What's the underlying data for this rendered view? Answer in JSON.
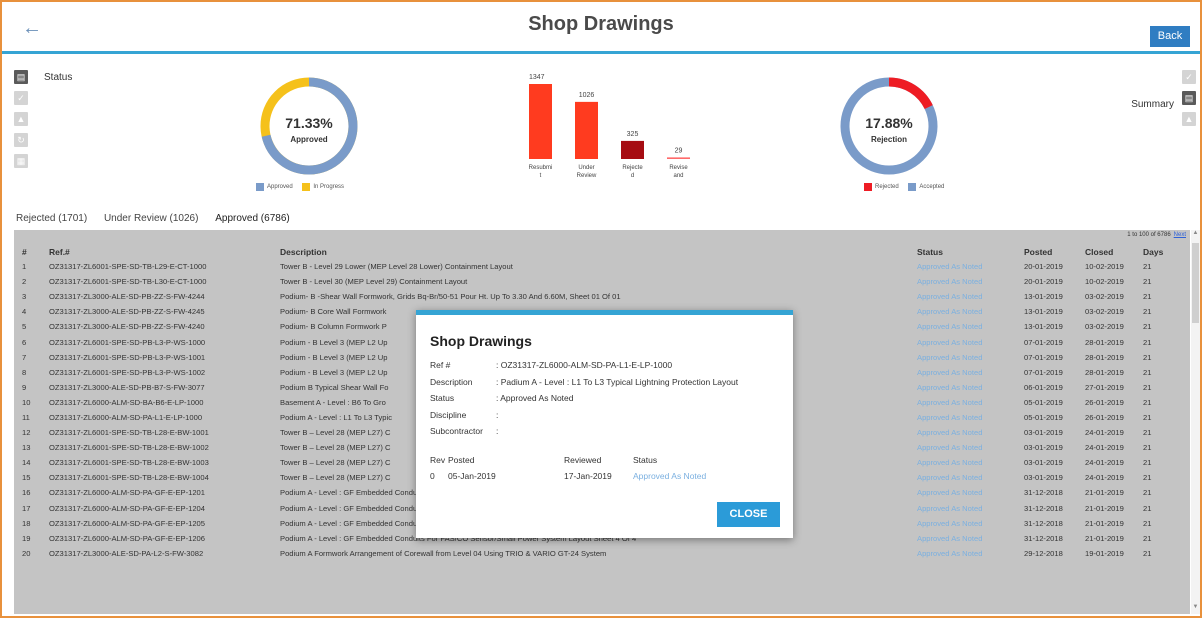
{
  "header": {
    "title": "Shop Drawings",
    "back_label": "Back"
  },
  "status_label": "Status",
  "summary_label": "Summary",
  "approval_donut": {
    "percent": "71.33%",
    "label": "Approved",
    "fraction": 0.7133,
    "legend": [
      "Approved",
      "In Progress"
    ],
    "colors": [
      "#7a9bc9",
      "#f5c11b"
    ]
  },
  "rejection_donut": {
    "percent": "17.88%",
    "label": "Rejection",
    "fraction": 0.1788,
    "legend": [
      "Rejected",
      "Accepted"
    ],
    "colors": [
      "#ee1c24",
      "#7a9bc9"
    ]
  },
  "chart_data": {
    "type": "bar",
    "categories": [
      "Resubmit",
      "Under Review",
      "Rejected",
      "Revise and"
    ],
    "category_lines": [
      [
        "Resubmi",
        "t"
      ],
      [
        "Under",
        "Review"
      ],
      [
        "Rejecte",
        "d"
      ],
      [
        "Revise",
        "and"
      ]
    ],
    "values": [
      1347,
      1026,
      325,
      29
    ],
    "colors": [
      "#ff3b1f",
      "#ff3b1f",
      "#a60c12",
      "#ff6a6a"
    ],
    "ylim": [
      0,
      1347
    ]
  },
  "tabs": [
    {
      "label": "Rejected (1701)"
    },
    {
      "label": "Under Review (1026)"
    },
    {
      "label": "Approved (6786)"
    }
  ],
  "pager": {
    "range": "1 to 100 of 6786",
    "next": "Next"
  },
  "table": {
    "headers": [
      "#",
      "Ref.#",
      "Description",
      "Status",
      "Posted",
      "Closed",
      "Days"
    ],
    "rows": [
      [
        "1",
        "OZ31317-ZL6001-SPE-SD-TB-L29-E-CT-1000",
        "Tower B - Level 29 Lower (MEP Level 28 Lower) Containment Layout",
        "Approved As Noted",
        "20-01-2019",
        "10-02-2019",
        "21"
      ],
      [
        "2",
        "OZ31317-ZL6001-SPE-SD-TB-L30-E-CT-1000",
        "Tower B - Level 30 (MEP Level 29) Containment Layout",
        "Approved As Noted",
        "20-01-2019",
        "10-02-2019",
        "21"
      ],
      [
        "3",
        "OZ31317-ZL3000-ALE-SD-PB-ZZ-S-FW-4244",
        "Podium- B -Shear Wall Formwork, Grids Bq-Br/50-51 Pour Ht. Up To 3.30 And 6.60M, Sheet 01 Of 01",
        "Approved As Noted",
        "13-01-2019",
        "03-02-2019",
        "21"
      ],
      [
        "4",
        "OZ31317-ZL3000-ALE-SD-PB-ZZ-S-FW-4245",
        "Podium- B Core Wall Formwork",
        "Approved As Noted",
        "13-01-2019",
        "03-02-2019",
        "21"
      ],
      [
        "5",
        "OZ31317-ZL3000-ALE-SD-PB-ZZ-S-FW-4240",
        "Podium- B Column Formwork P",
        "Approved As Noted",
        "13-01-2019",
        "03-02-2019",
        "21"
      ],
      [
        "6",
        "OZ31317-ZL6001-SPE-SD-PB-L3-P-WS-1000",
        "Podium - B Level 3 (MEP L2 Up",
        "Approved As Noted",
        "07-01-2019",
        "28-01-2019",
        "21"
      ],
      [
        "7",
        "OZ31317-ZL6001-SPE-SD-PB-L3-P-WS-1001",
        "Podium - B Level 3 (MEP L2 Up",
        "Approved As Noted",
        "07-01-2019",
        "28-01-2019",
        "21"
      ],
      [
        "8",
        "OZ31317-ZL6001-SPE-SD-PB-L3-P-WS-1002",
        "Podium - B Level 3 (MEP L2 Up",
        "Approved As Noted",
        "07-01-2019",
        "28-01-2019",
        "21"
      ],
      [
        "9",
        "OZ31317-ZL3000-ALE-SD-PB-B7-S-FW-3077",
        "Podium B Typical Shear Wall Fo",
        "Approved As Noted",
        "06-01-2019",
        "27-01-2019",
        "21"
      ],
      [
        "10",
        "OZ31317-ZL6000-ALM-SD-BA-B6-E-LP-1000",
        "Basement A - Level : B6 To Gro",
        "Approved As Noted",
        "05-01-2019",
        "26-01-2019",
        "21"
      ],
      [
        "11",
        "OZ31317-ZL6000-ALM-SD-PA-L1-E-LP-1000",
        "Podium A - Level : L1 To L3 Typic",
        "Approved As Noted",
        "05-01-2019",
        "26-01-2019",
        "21"
      ],
      [
        "12",
        "OZ31317-ZL6001-SPE-SD-TB-L28-E-BW-1001",
        "Tower B – Level 28 (MEP L27) C",
        "Approved As Noted",
        "03-01-2019",
        "24-01-2019",
        "21"
      ],
      [
        "13",
        "OZ31317-ZL6001-SPE-SD-TB-L28-E-BW-1002",
        "Tower B – Level 28 (MEP L27) C",
        "Approved As Noted",
        "03-01-2019",
        "24-01-2019",
        "21"
      ],
      [
        "14",
        "OZ31317-ZL6001-SPE-SD-TB-L28-E-BW-1003",
        "Tower B – Level 28 (MEP L27) C",
        "Approved As Noted",
        "03-01-2019",
        "24-01-2019",
        "21"
      ],
      [
        "15",
        "OZ31317-ZL6001-SPE-SD-TB-L28-E-BW-1004",
        "Tower B – Level 28 (MEP L27) C",
        "Approved As Noted",
        "03-01-2019",
        "24-01-2019",
        "21"
      ],
      [
        "16",
        "OZ31317-ZL6000-ALM-SD-PA-GF-E-EP-1201",
        "Podium A - Level : GF Embedded Conduits For FAS/CO Sensor/Small Power System Layout Sheet 1 Of 4",
        "Approved As Noted",
        "31-12-2018",
        "21-01-2019",
        "21"
      ],
      [
        "17",
        "OZ31317-ZL6000-ALM-SD-PA-GF-E-EP-1204",
        "Podium A - Level : GF Embedded Conduits For FAS/CO Sensor/Small Power System Layout Sheet 2 Of 4 \"",
        "Approved As Noted",
        "31-12-2018",
        "21-01-2019",
        "21"
      ],
      [
        "18",
        "OZ31317-ZL6000-ALM-SD-PA-GF-E-EP-1205",
        "Podium A - Level : GF Embedded Conduits For FAS/CO Sensor/Small Power System Layout Sheet 3 Of 4",
        "Approved As Noted",
        "31-12-2018",
        "21-01-2019",
        "21"
      ],
      [
        "19",
        "OZ31317-ZL6000-ALM-SD-PA-GF-E-EP-1206",
        "Podium A - Level : GF Embedded Conduits For FAS/CO Sensor/Small Power System Layout Sheet 4 Of 4",
        "Approved As Noted",
        "31-12-2018",
        "21-01-2019",
        "21"
      ],
      [
        "20",
        "OZ31317-ZL3000-ALE-SD-PA-L2-S-FW-3082",
        "Podium A Formwork Arrangement of Corewall from Level 04 Using TRIO & VARIO GT-24 System",
        "Approved As Noted",
        "29-12-2018",
        "19-01-2019",
        "21"
      ]
    ]
  },
  "modal": {
    "title": "Shop Drawings",
    "fields": [
      {
        "key": "Ref #",
        "value": ": OZ31317-ZL6000-ALM-SD-PA-L1-E-LP-1000"
      },
      {
        "key": "Description",
        "value": ": Padium A - Level : L1 To L3 Typical Lightning Protection Layout"
      },
      {
        "key": "Status",
        "value": ": Approved As Noted"
      },
      {
        "key": "Discipline",
        "value": ":"
      },
      {
        "key": "Subcontractor",
        "value": ":"
      }
    ],
    "history_headers": [
      "Rev",
      "Posted",
      "Reviewed",
      "Status"
    ],
    "history_row": [
      "0",
      "05-Jan-2019",
      "17-Jan-2019",
      "Approved As Noted"
    ],
    "close_label": "CLOSE"
  },
  "colors": {
    "accent": "#35a4d4",
    "button": "#2f7dc2",
    "status_link": "#7bb0e0",
    "frame": "#e8913c"
  }
}
